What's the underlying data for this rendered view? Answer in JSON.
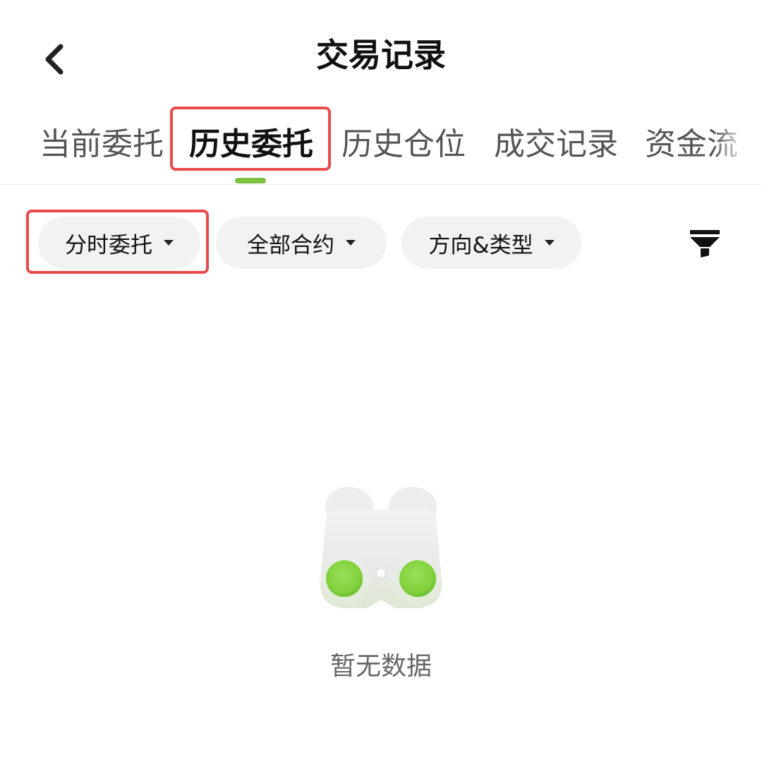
{
  "header": {
    "title": "交易记录",
    "back_icon": "chevron-left-icon"
  },
  "tabs": [
    {
      "label": "当前委托",
      "active": false
    },
    {
      "label": "历史委托",
      "active": true
    },
    {
      "label": "历史仓位",
      "active": false
    },
    {
      "label": "成交记录",
      "active": false
    },
    {
      "label": "资金流",
      "active": false
    }
  ],
  "filters": [
    {
      "label": "分时委托",
      "icon": "caret-down-icon"
    },
    {
      "label": "全部合约",
      "icon": "caret-down-icon"
    },
    {
      "label": "方向&类型",
      "icon": "caret-down-icon"
    }
  ],
  "filter_button_icon": "funnel-icon",
  "empty_state": {
    "text": "暂无数据",
    "icon": "binoculars-icon"
  },
  "colors": {
    "accent": "#7cc142",
    "highlight": "#e84b4b",
    "chip_bg": "#f2f2f2",
    "text_primary": "#111111",
    "text_secondary": "#555555"
  }
}
